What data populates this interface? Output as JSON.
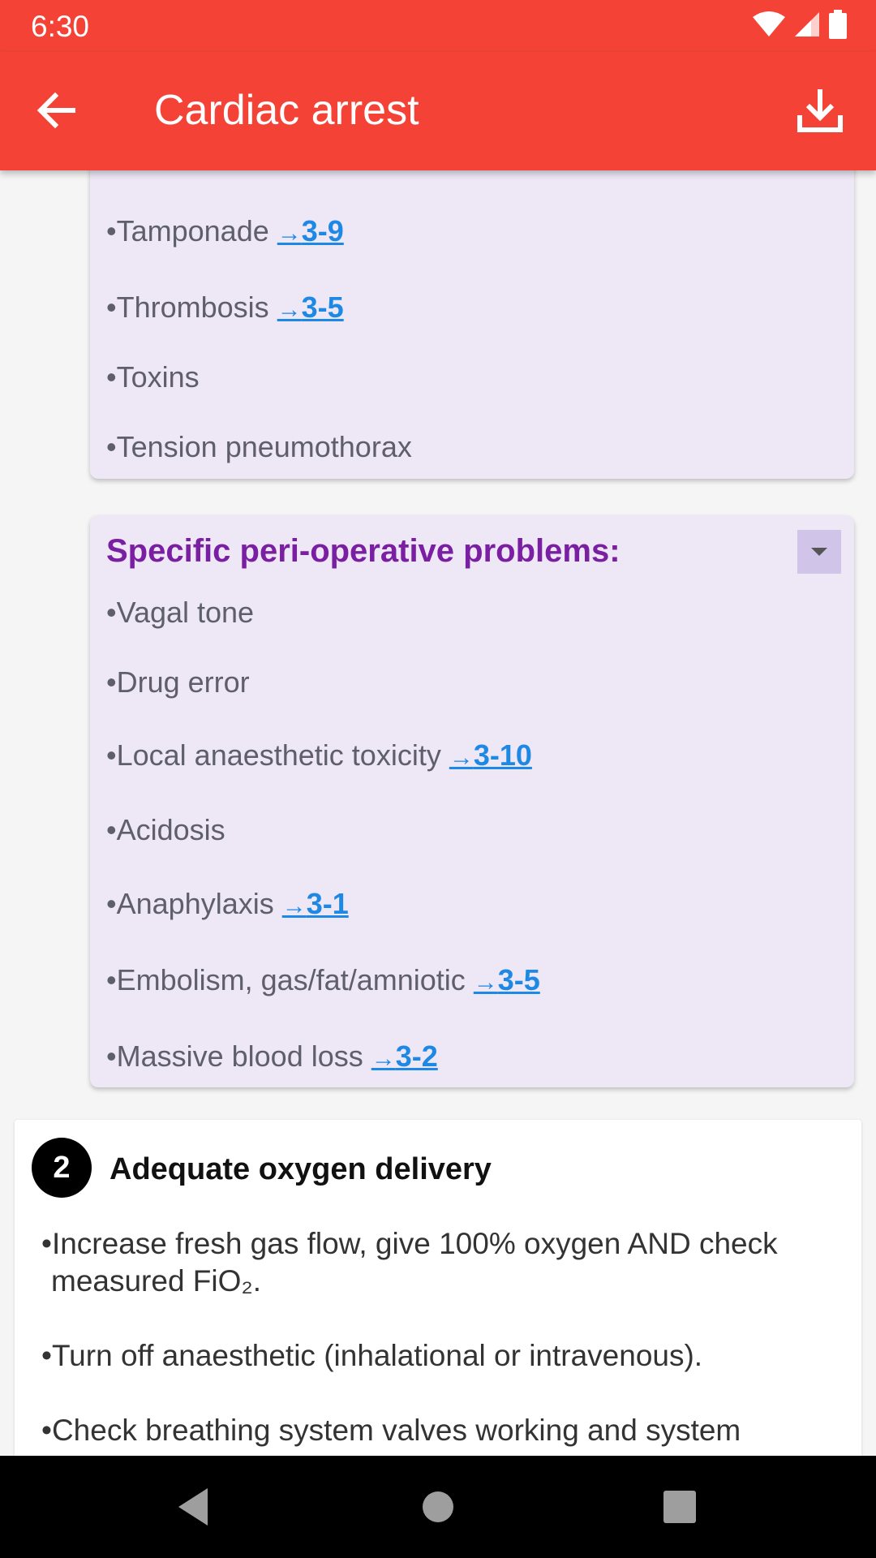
{
  "status": {
    "time": "6:30"
  },
  "appbar": {
    "title": "Cardiac arrest"
  },
  "causes_card": {
    "items": [
      {
        "text": "•Tamponade",
        "link": "3-9"
      },
      {
        "text": "•Thrombosis",
        "link": "3-5"
      },
      {
        "text": "•Toxins"
      },
      {
        "text": "•Tension pneumothorax"
      }
    ]
  },
  "periop_card": {
    "title": "Specific peri-operative problems:",
    "items": [
      {
        "text": "•Vagal tone"
      },
      {
        "text": "•Drug error"
      },
      {
        "text": "•Local anaesthetic toxicity",
        "link": "3-10"
      },
      {
        "text": "•Acidosis"
      },
      {
        "text": "•Anaphylaxis",
        "link": "3-1"
      },
      {
        "text": "•Embolism, gas/fat/amniotic",
        "link": "3-5"
      },
      {
        "text": "•Massive blood loss",
        "link": "3-2"
      }
    ]
  },
  "section2": {
    "number": "2",
    "heading": "Adequate oxygen delivery",
    "p1_line1": "•Increase fresh gas flow, give 100% oxygen AND check",
    "p1_line2": "measured FiO₂.",
    "p2": "•Turn off anaesthetic (inhalational or intravenous).",
    "p3": "•Check breathing system valves working and system"
  },
  "icons": {
    "back": "arrow-back-icon",
    "download": "download-icon",
    "wifi": "wifi-icon",
    "signal": "signal-icon",
    "battery": "battery-icon",
    "dropdown": "dropdown-arrow-icon",
    "nav_back": "nav-back-icon",
    "nav_home": "nav-home-icon",
    "nav_recents": "nav-recents-icon"
  },
  "colors": {
    "appbar": "#f44336",
    "card_bg": "#ede7f6",
    "card_title": "#7b1fa2",
    "link": "#1e88e5"
  }
}
